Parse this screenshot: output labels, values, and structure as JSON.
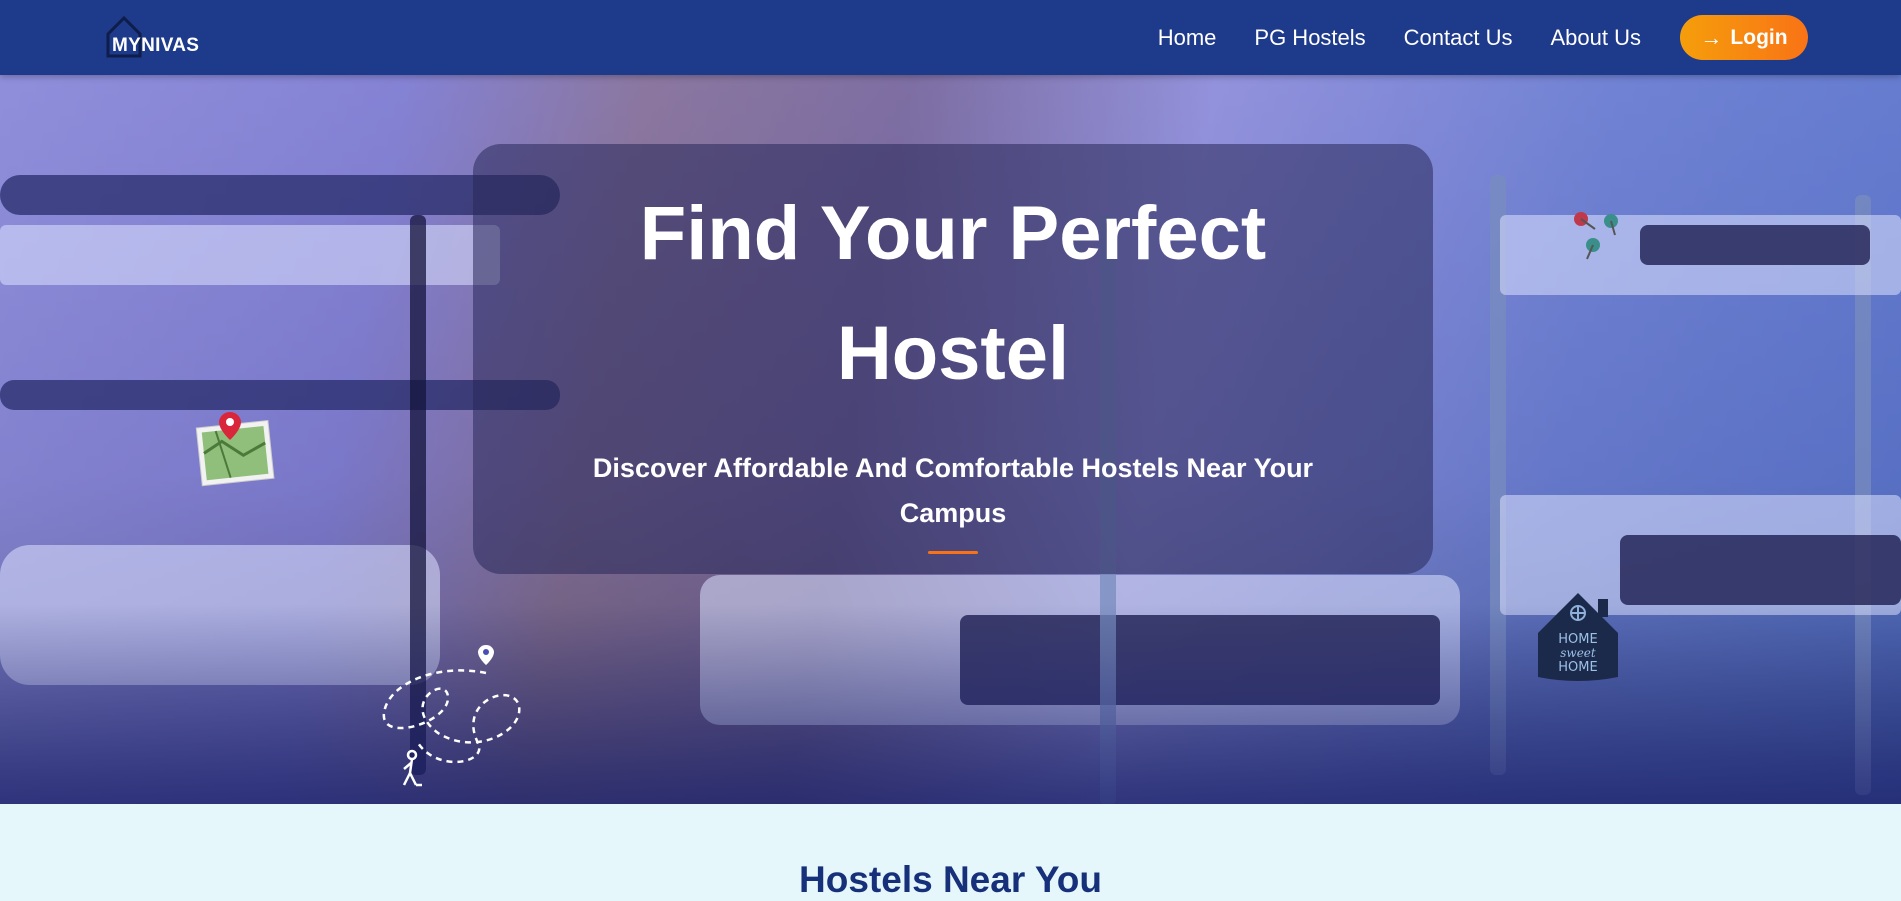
{
  "brand": {
    "logo_text": "MYNIVAS"
  },
  "nav": {
    "links": [
      "Home",
      "PG Hostels",
      "Contact Us",
      "About Us"
    ],
    "login_label": "Login"
  },
  "hero": {
    "title": "Find Your Perfect Hostel",
    "subtitle": "Discover Affordable And Comfortable Hostels Near Your Campus",
    "decor_icons": [
      "map-pin-icon",
      "push-pins-icon",
      "dotted-trail-icon",
      "home-sweet-home-icon"
    ],
    "home_badge_text": "HOME sweet HOME"
  },
  "section": {
    "title": "Hostels Near You"
  },
  "colors": {
    "navbar": "#1e3a8a",
    "accent": "#f97316",
    "section_bg": "#e6f7fc",
    "section_title": "#16307a"
  }
}
